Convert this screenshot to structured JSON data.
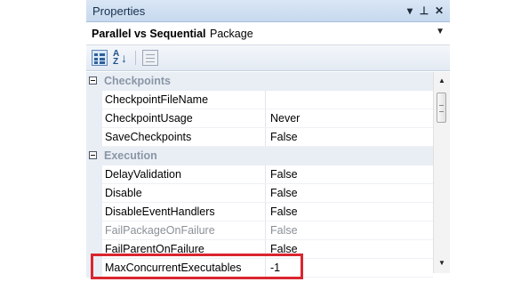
{
  "window": {
    "title": "Properties",
    "dropdown_icon": "dropdown-arrow-icon",
    "pin_icon": "pin-icon",
    "close_icon": "close-icon"
  },
  "object_selector": {
    "name": "Parallel vs Sequential",
    "type": "Package"
  },
  "toolbar": {
    "categorized_icon": "categorized-view-icon",
    "alphabetical_icon": "alphabetical-sort-icon",
    "property_pages_icon": "property-pages-icon"
  },
  "grid": {
    "categories": [
      {
        "label": "Checkpoints",
        "properties": [
          {
            "name": "CheckpointFileName",
            "value": "",
            "disabled": false
          },
          {
            "name": "CheckpointUsage",
            "value": "Never",
            "disabled": false
          },
          {
            "name": "SaveCheckpoints",
            "value": "False",
            "disabled": false
          }
        ]
      },
      {
        "label": "Execution",
        "properties": [
          {
            "name": "DelayValidation",
            "value": "False",
            "disabled": false
          },
          {
            "name": "Disable",
            "value": "False",
            "disabled": false
          },
          {
            "name": "DisableEventHandlers",
            "value": "False",
            "disabled": false
          },
          {
            "name": "FailPackageOnFailure",
            "value": "False",
            "disabled": true
          },
          {
            "name": "FailParentOnFailure",
            "value": "False",
            "disabled": false
          },
          {
            "name": "MaxConcurrentExecutables",
            "value": "-1",
            "disabled": false
          }
        ]
      }
    ]
  },
  "highlight_color": "#d9262f"
}
